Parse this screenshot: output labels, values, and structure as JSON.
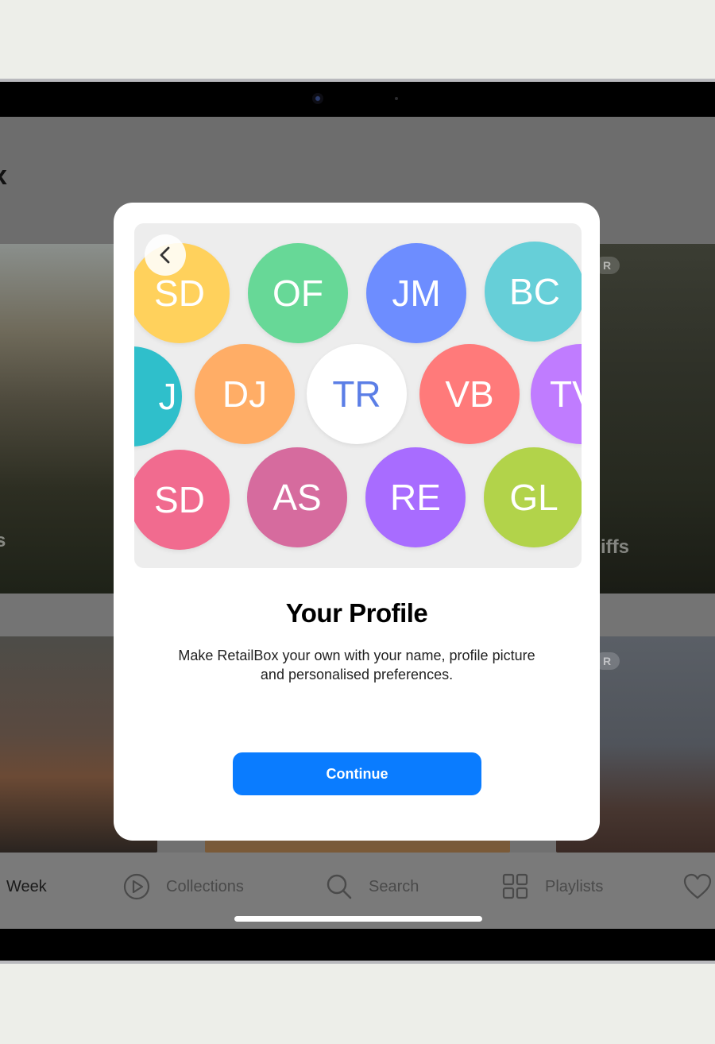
{
  "background": {
    "header_glyph": "x",
    "badge_text": "R",
    "caption_left": "s",
    "caption_right": "iffs",
    "colors": {
      "page": "#edeee9",
      "frame": "#000000"
    }
  },
  "tabbar": {
    "week_label": "Week",
    "collections_label": "Collections",
    "search_label": "Search",
    "playlists_label": "Playlists"
  },
  "modal": {
    "title": "Your Profile",
    "description": "Make RetailBox your own with your name, profile picture and personalised preferences.",
    "continue_label": "Continue",
    "accent": "#0a7cff",
    "avatars": [
      {
        "initials": "SD",
        "color": "#ffd15c",
        "text_color": "#ffffff"
      },
      {
        "initials": "OF",
        "color": "#67d897",
        "text_color": "#ffffff"
      },
      {
        "initials": "JM",
        "color": "#6d8dff",
        "text_color": "#ffffff"
      },
      {
        "initials": "BC",
        "color": "#66cfd8",
        "text_color": "#ffffff"
      },
      {
        "initials": "J",
        "color": "#2fbfcb",
        "text_color": "#ffffff"
      },
      {
        "initials": "DJ",
        "color": "#ffad66",
        "text_color": "#ffffff"
      },
      {
        "initials": "TR",
        "color": "#ffffff",
        "text_color": "#5b7ee6"
      },
      {
        "initials": "VB",
        "color": "#ff7a7a",
        "text_color": "#ffffff"
      },
      {
        "initials": "TV",
        "color": "#c07cff",
        "text_color": "#ffffff"
      },
      {
        "initials": "SD",
        "color": "#f16b8f",
        "text_color": "#ffffff"
      },
      {
        "initials": "AS",
        "color": "#d66b9e",
        "text_color": "#ffffff"
      },
      {
        "initials": "RE",
        "color": "#a86cff",
        "text_color": "#ffffff"
      },
      {
        "initials": "GL",
        "color": "#b2d34a",
        "text_color": "#ffffff"
      }
    ]
  }
}
